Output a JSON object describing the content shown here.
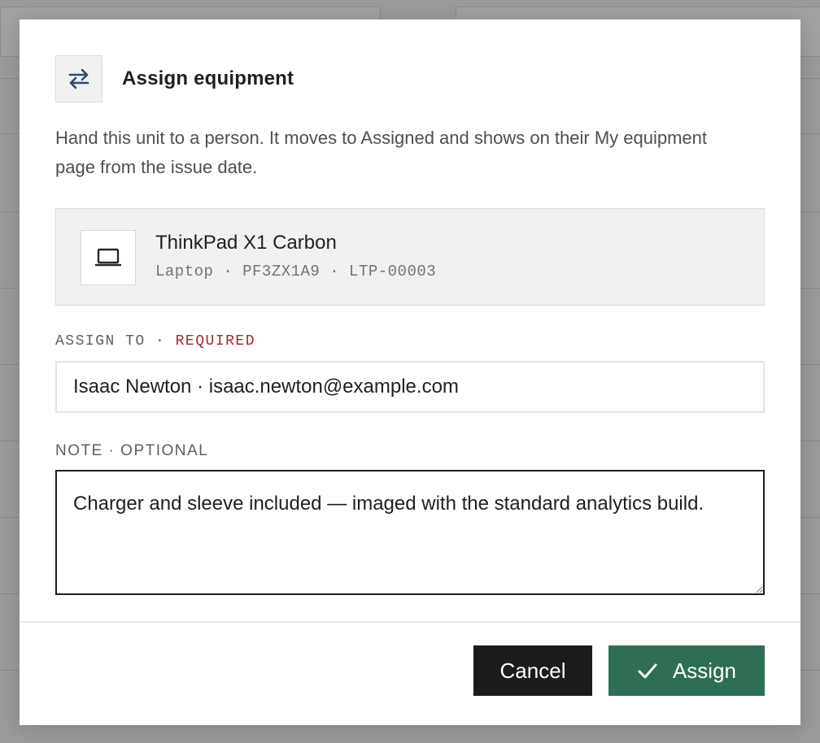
{
  "dialog": {
    "title": "Assign equipment",
    "description": "Hand this unit to a person. It moves to Assigned and shows on their My equipment page from the issue date.",
    "header_icon": "swap-arrows-icon"
  },
  "item": {
    "icon": "laptop-icon",
    "name": "ThinkPad X1 Carbon",
    "meta": "Laptop · PF3ZX1A9 · LTP-00003"
  },
  "assign_to": {
    "label": "ASSIGN TO · ",
    "required_label": "REQUIRED",
    "value": "Isaac Newton · isaac.newton@example.com"
  },
  "note": {
    "label": "NOTE · OPTIONAL",
    "value": "Charger and sleeve included — imaged with the standard analytics build."
  },
  "buttons": {
    "cancel_label": "Cancel",
    "assign_label": "Assign",
    "assign_icon": "check-icon"
  },
  "colors": {
    "required": "#a12a2a",
    "assign_button": "#2e6e54",
    "cancel_button": "#1c1c1c",
    "header_icon": "#2f4a6b"
  }
}
